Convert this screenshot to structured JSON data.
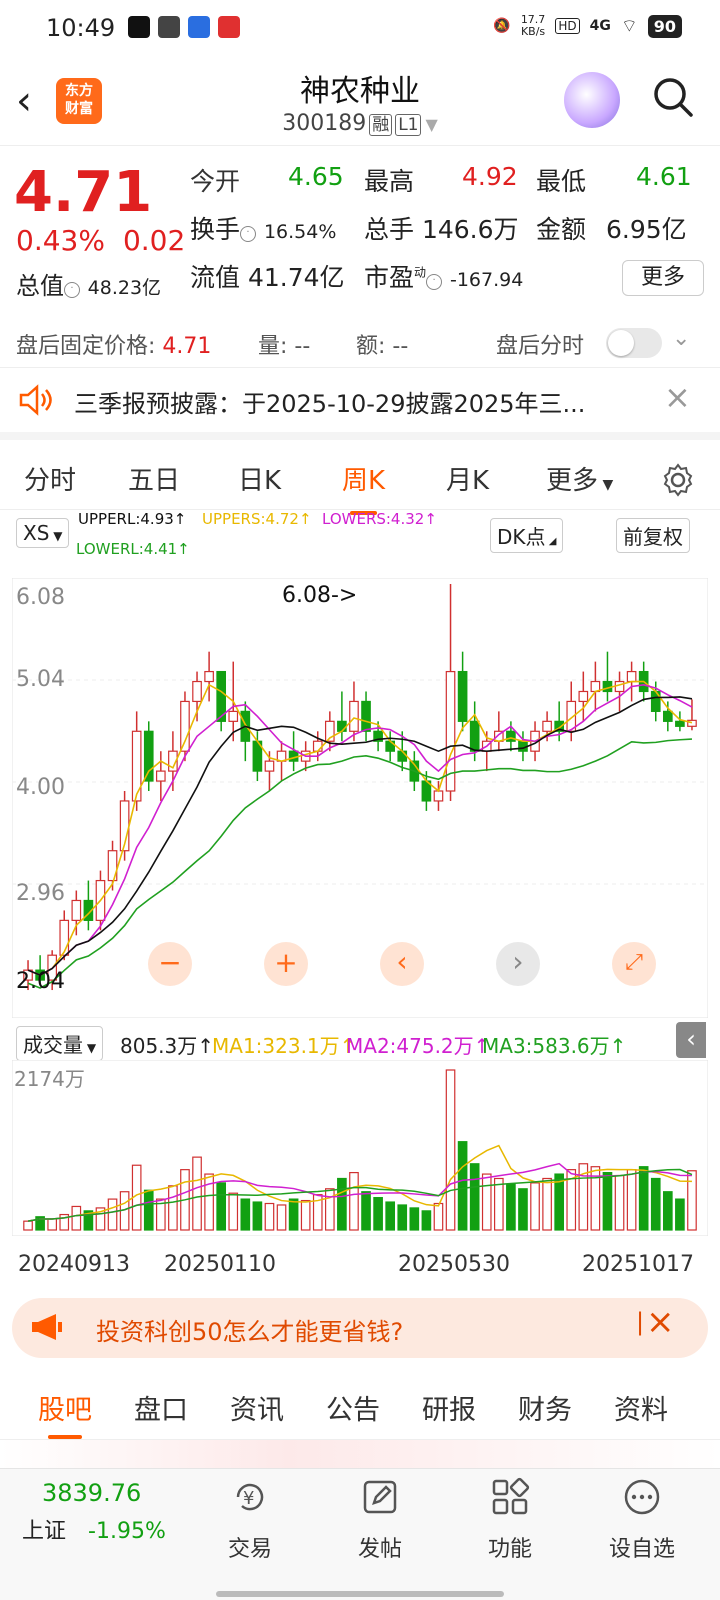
{
  "status": {
    "time": "10:49",
    "net_speed_top": "17.7",
    "net_speed_bottom": "KB/s",
    "hd": "HD",
    "network": "4G",
    "battery": "90"
  },
  "header": {
    "logo_text_1": "东方",
    "logo_text_2": "财富",
    "title": "神农种业",
    "code": "300189",
    "tag_margin": "融",
    "tag_level": "L1"
  },
  "quote": {
    "price": "4.71",
    "change_pct": "0.43%",
    "change_abs": "0.02",
    "open_label": "今开",
    "open": "4.65",
    "high_label": "最高",
    "high": "4.92",
    "low_label": "最低",
    "low": "4.61",
    "turnover_label": "换手",
    "turnover": "16.54%",
    "volume_label": "总手",
    "volume": "146.6万",
    "amount_label": "金额",
    "amount": "6.95亿",
    "mktcap_label": "总值",
    "mktcap": "48.23亿",
    "float_label": "流值",
    "float": "41.74亿",
    "pe_label": "市盈",
    "pe_sup": "动",
    "pe": "-167.94",
    "more": "更多"
  },
  "afterhours": {
    "price_label": "盘后固定价格:",
    "price": "4.71",
    "vol_label": "量:",
    "vol": "--",
    "amt_label": "额:",
    "amt": "--",
    "toggle_label": "盘后分时"
  },
  "notice": {
    "text": "三季报预披露：于2025-10-29披露2025年三..."
  },
  "period_tabs": [
    "分时",
    "五日",
    "日K",
    "周K",
    "月K",
    "更多"
  ],
  "indicators": {
    "selector": "XS",
    "upperl": "UPPERL:4.93↑",
    "uppers": "UPPERS:4.72↑",
    "lowers": "LOWERS:4.32↑",
    "lowerl": "LOWERL:4.41↑",
    "dk": "DK点",
    "adjust": "前复权"
  },
  "chart_labels": {
    "y_top": "6.08",
    "y_mid1": "5.04",
    "y_mid2": "4.00",
    "y_mid3": "2.96",
    "y_low_annot": "2.04",
    "high_annot": "6.08->"
  },
  "colors": {
    "up": "#d03030",
    "down": "#12a012",
    "upperl": "#111111",
    "uppers": "#e8b800",
    "lowers": "#d020d0",
    "lowerl": "#20a020",
    "accent": "#ff5a00"
  },
  "volume": {
    "selector": "成交量",
    "vol": "805.3万↑",
    "ma1": "MA1:323.1万↑",
    "ma2": "MA2:475.2万↑",
    "ma3": "MA3:583.6万↑",
    "y_top": "2174万"
  },
  "dates": [
    "20240913",
    "20250110",
    "20250530",
    "20251017"
  ],
  "promo": {
    "text": "投资科创50怎么才能更省钱?"
  },
  "bottom_tabs": [
    "股吧",
    "盘口",
    "资讯",
    "公告",
    "研报",
    "财务",
    "资料"
  ],
  "navbar": {
    "index_value": "3839.76",
    "index_name": "上证",
    "index_chg": "-1.95%",
    "trade": "交易",
    "post": "发帖",
    "func": "功能",
    "watch": "设自选"
  },
  "chart_data": {
    "type": "candlestick",
    "ylim": [
      1.92,
      6.08
    ],
    "ohlc": [
      [
        2.1,
        2.3,
        2.0,
        2.2
      ],
      [
        2.2,
        2.35,
        2.05,
        2.1
      ],
      [
        2.1,
        2.4,
        2.0,
        2.35
      ],
      [
        2.35,
        2.8,
        2.3,
        2.7
      ],
      [
        2.7,
        3.0,
        2.55,
        2.9
      ],
      [
        2.9,
        3.1,
        2.6,
        2.7
      ],
      [
        2.7,
        3.2,
        2.6,
        3.1
      ],
      [
        3.1,
        3.5,
        3.0,
        3.4
      ],
      [
        3.4,
        4.0,
        3.3,
        3.9
      ],
      [
        3.9,
        4.8,
        3.8,
        4.6
      ],
      [
        4.6,
        4.7,
        4.0,
        4.1
      ],
      [
        4.1,
        4.4,
        3.9,
        4.2
      ],
      [
        4.2,
        4.6,
        4.0,
        4.4
      ],
      [
        4.4,
        5.0,
        4.3,
        4.9
      ],
      [
        4.9,
        5.2,
        4.7,
        5.1
      ],
      [
        5.1,
        5.4,
        4.9,
        5.2
      ],
      [
        5.2,
        5.1,
        4.6,
        4.7
      ],
      [
        4.7,
        5.3,
        4.5,
        4.8
      ],
      [
        4.8,
        4.9,
        4.3,
        4.5
      ],
      [
        4.5,
        4.6,
        4.1,
        4.2
      ],
      [
        4.2,
        4.4,
        4.0,
        4.3
      ],
      [
        4.3,
        4.5,
        4.1,
        4.4
      ],
      [
        4.4,
        4.6,
        4.2,
        4.3
      ],
      [
        4.3,
        4.5,
        4.2,
        4.4
      ],
      [
        4.4,
        4.6,
        4.3,
        4.5
      ],
      [
        4.5,
        4.8,
        4.4,
        4.7
      ],
      [
        4.7,
        5.0,
        4.5,
        4.6
      ],
      [
        4.6,
        5.1,
        4.5,
        4.9
      ],
      [
        4.9,
        5.0,
        4.5,
        4.6
      ],
      [
        4.6,
        4.7,
        4.4,
        4.5
      ],
      [
        4.5,
        4.6,
        4.3,
        4.4
      ],
      [
        4.4,
        4.6,
        4.2,
        4.3
      ],
      [
        4.3,
        4.4,
        4.0,
        4.1
      ],
      [
        4.1,
        4.2,
        3.8,
        3.9
      ],
      [
        3.9,
        4.1,
        3.8,
        4.0
      ],
      [
        4.0,
        6.08,
        3.9,
        5.2
      ],
      [
        5.2,
        5.4,
        4.6,
        4.7
      ],
      [
        4.7,
        4.9,
        4.3,
        4.4
      ],
      [
        4.4,
        4.6,
        4.2,
        4.5
      ],
      [
        4.5,
        4.8,
        4.4,
        4.6
      ],
      [
        4.6,
        4.7,
        4.4,
        4.5
      ],
      [
        4.5,
        4.6,
        4.3,
        4.4
      ],
      [
        4.4,
        4.7,
        4.3,
        4.6
      ],
      [
        4.6,
        4.8,
        4.5,
        4.7
      ],
      [
        4.7,
        4.9,
        4.5,
        4.6
      ],
      [
        4.6,
        5.1,
        4.5,
        4.9
      ],
      [
        4.9,
        5.2,
        4.7,
        5.0
      ],
      [
        5.0,
        5.3,
        4.8,
        5.1
      ],
      [
        5.1,
        5.4,
        4.9,
        5.0
      ],
      [
        5.0,
        5.2,
        4.8,
        5.1
      ],
      [
        5.1,
        5.3,
        4.9,
        5.2
      ],
      [
        5.2,
        5.3,
        4.9,
        5.0
      ],
      [
        5.0,
        5.1,
        4.7,
        4.8
      ],
      [
        4.8,
        4.9,
        4.6,
        4.7
      ],
      [
        4.7,
        4.8,
        4.6,
        4.65
      ],
      [
        4.65,
        4.92,
        4.61,
        4.71
      ]
    ],
    "volume": [
      120,
      180,
      150,
      210,
      320,
      260,
      300,
      420,
      520,
      880,
      540,
      420,
      600,
      820,
      990,
      760,
      640,
      500,
      420,
      380,
      360,
      340,
      420,
      400,
      480,
      560,
      700,
      780,
      520,
      440,
      380,
      340,
      300,
      260,
      360,
      2174,
      1200,
      900,
      760,
      700,
      620,
      560,
      640,
      700,
      760,
      820,
      900,
      860,
      780,
      740,
      820,
      860,
      700,
      520,
      420,
      805
    ]
  }
}
